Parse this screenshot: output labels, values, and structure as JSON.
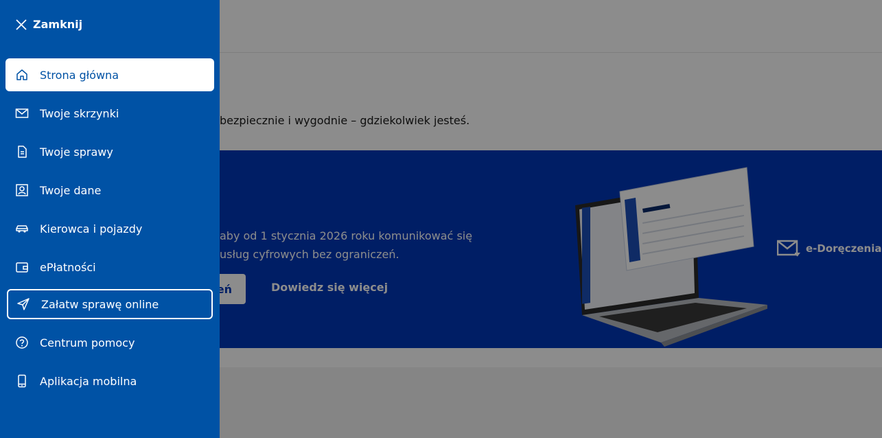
{
  "background": {
    "intro_text": "bezpiecznie i wygodnie – gdziekolwiek jesteś.",
    "banner": {
      "line1": "aby od 1 stycznia 2026 roku komunikować się",
      "line2": "usług cyfrowych bez ograniczeń.",
      "primary_button_fragment": "eń",
      "secondary_link": "Dowiedz się więcej",
      "brand_label": "e-Doręczenia",
      "color": "#0038b8"
    }
  },
  "sidebar": {
    "close_label": "Zamknij",
    "color": "#0052a5",
    "items": [
      {
        "label": "Strona główna",
        "icon": "home-icon",
        "state": "active"
      },
      {
        "label": "Twoje skrzynki",
        "icon": "mail-icon",
        "state": "normal"
      },
      {
        "label": "Twoje sprawy",
        "icon": "document-icon",
        "state": "normal"
      },
      {
        "label": "Twoje dane",
        "icon": "user-card-icon",
        "state": "normal"
      },
      {
        "label": "Kierowca i pojazdy",
        "icon": "car-icon",
        "state": "normal"
      },
      {
        "label": "ePłatności",
        "icon": "wallet-icon",
        "state": "normal"
      },
      {
        "label": "Załatw sprawę online",
        "icon": "send-icon",
        "state": "focused"
      },
      {
        "label": "Centrum pomocy",
        "icon": "help-icon",
        "state": "normal"
      },
      {
        "label": "Aplikacja mobilna",
        "icon": "phone-icon",
        "state": "normal"
      }
    ]
  }
}
